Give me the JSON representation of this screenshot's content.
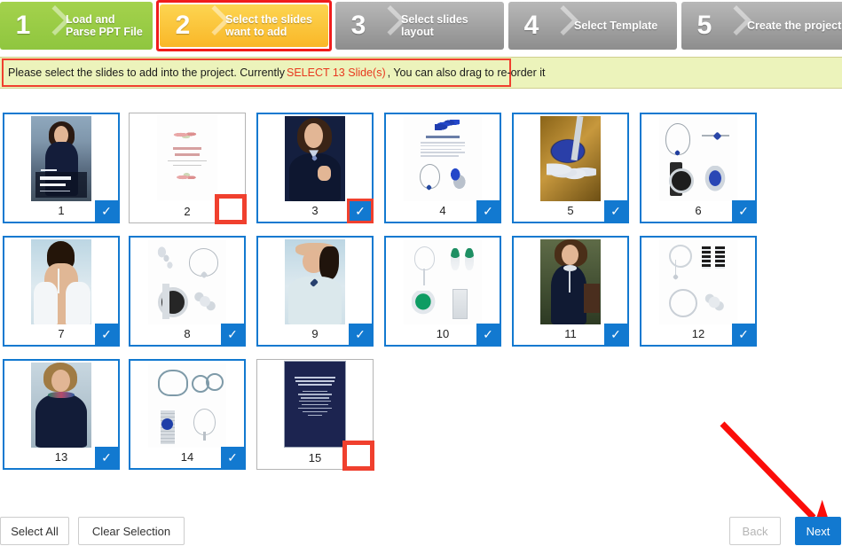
{
  "steps": [
    {
      "num": "1",
      "label": "Load and Parse PPT File",
      "state": "done"
    },
    {
      "num": "2",
      "label": "Select the slides want to add",
      "state": "active"
    },
    {
      "num": "3",
      "label": "Select slides layout",
      "state": "todo"
    },
    {
      "num": "4",
      "label": "Select Template",
      "state": "todo"
    },
    {
      "num": "5",
      "label": "Create the project",
      "state": "todo"
    }
  ],
  "notice": {
    "prefix": "Please select the slides to add into the project. Currently ",
    "highlight": "SELECT 13 Slide(s)",
    "suffix": ", You can also drag to re-order it"
  },
  "slides": [
    {
      "number": "1",
      "selected": true,
      "highlight": false,
      "check": "✓"
    },
    {
      "number": "2",
      "selected": false,
      "highlight": true,
      "check": ""
    },
    {
      "number": "3",
      "selected": true,
      "highlight": true,
      "check": "✓"
    },
    {
      "number": "4",
      "selected": true,
      "highlight": false,
      "check": "✓"
    },
    {
      "number": "5",
      "selected": true,
      "highlight": false,
      "check": "✓"
    },
    {
      "number": "6",
      "selected": true,
      "highlight": false,
      "check": "✓"
    },
    {
      "number": "7",
      "selected": true,
      "highlight": false,
      "check": "✓"
    },
    {
      "number": "8",
      "selected": true,
      "highlight": false,
      "check": "✓"
    },
    {
      "number": "9",
      "selected": true,
      "highlight": false,
      "check": "✓"
    },
    {
      "number": "10",
      "selected": true,
      "highlight": false,
      "check": "✓"
    },
    {
      "number": "11",
      "selected": true,
      "highlight": false,
      "check": "✓"
    },
    {
      "number": "12",
      "selected": true,
      "highlight": false,
      "check": "✓"
    },
    {
      "number": "13",
      "selected": true,
      "highlight": false,
      "check": "✓"
    },
    {
      "number": "14",
      "selected": true,
      "highlight": false,
      "check": "✓"
    },
    {
      "number": "15",
      "selected": false,
      "highlight": true,
      "check": ""
    }
  ],
  "slide_titles": {
    "s1_brand": "Piaget",
    "s1_line1": "EXTREMELY",
    "s1_line2": "COLORFUL",
    "s2_line1": "EXTREMELY",
    "s2_line2": "PIAGET",
    "s4_title": "EXTREMELY SPARKLING"
  },
  "footer": {
    "select_all": "Select All",
    "clear_selection": "Clear Selection",
    "back": "Back",
    "next": "Next"
  },
  "colors": {
    "accent_blue": "#1279d0",
    "step_done_green": "#8fc63f",
    "step_active_yellow": "#f9b728",
    "step_todo_gray": "#8d8d8d",
    "notice_bg": "#ecf3bb",
    "annotation_red": "#f0402e"
  }
}
